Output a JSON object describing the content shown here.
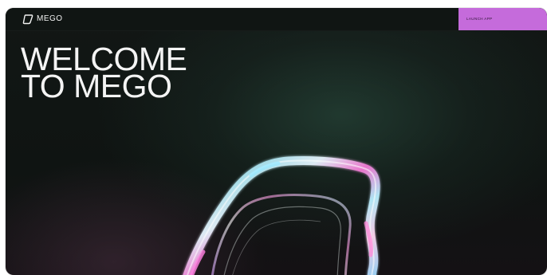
{
  "header": {
    "logo_text": "MEGO",
    "logo_icon": "mego-logo-icon",
    "launch_button_label": "LAUNCH APP"
  },
  "hero": {
    "title_line_1": "WELCOME",
    "title_line_2": "TO MEGO",
    "graphic": "iridescent-ring"
  },
  "colors": {
    "background": "#111614",
    "accent": "#c56bdb",
    "text": "#f4f4f4"
  }
}
